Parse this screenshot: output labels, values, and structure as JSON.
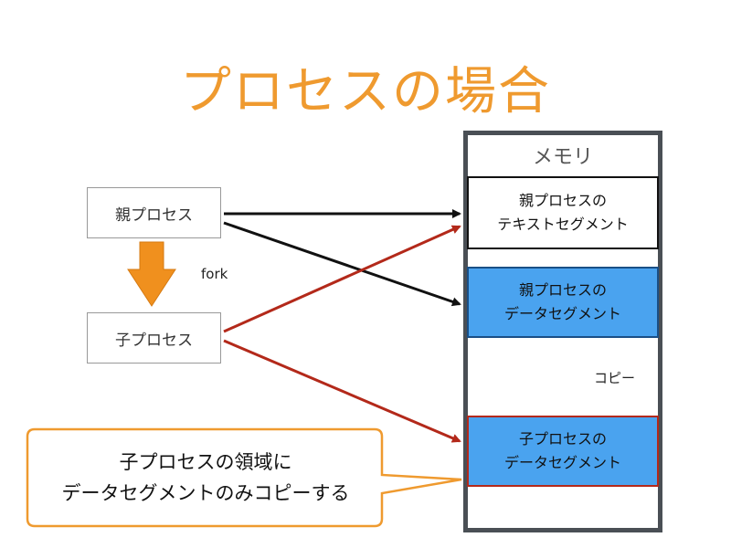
{
  "title": "プロセスの場合",
  "parent_process": "親プロセス",
  "child_process": "子プロセス",
  "fork_label": "fork",
  "memory": {
    "label": "メモリ",
    "text_segment": [
      "親プロセスの",
      "テキストセグメント"
    ],
    "parent_data_segment": [
      "親プロセスの",
      "データセグメント"
    ],
    "child_data_segment": [
      "子プロセスの",
      "データセグメント"
    ]
  },
  "copy_label": "コピー",
  "callout": [
    "子プロセスの領域に",
    "データセグメントのみコピーする"
  ],
  "colors": {
    "title": "#ef9a2f",
    "orange_arrow": "#f0901e",
    "black_arrow": "#111111",
    "red_arrow": "#b3291a",
    "segment_blue": "#4aa3ef"
  }
}
